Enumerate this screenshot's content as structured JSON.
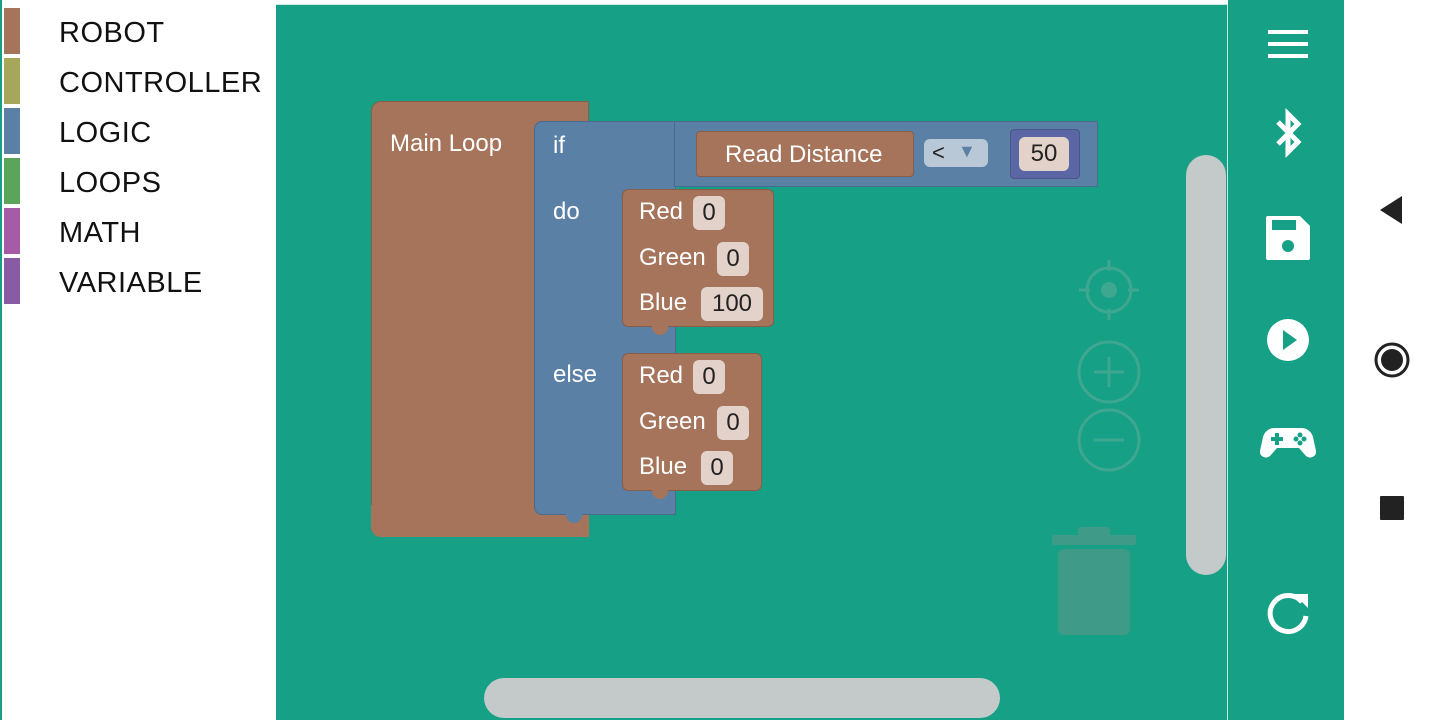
{
  "toolbox": {
    "categories": [
      {
        "label": "ROBOT",
        "color": "#a5745b"
      },
      {
        "label": "CONTROLLER",
        "color": "#a6a75b"
      },
      {
        "label": "LOGIC",
        "color": "#5b80a5"
      },
      {
        "label": "LOOPS",
        "color": "#5ba55b"
      },
      {
        "label": "MATH",
        "color": "#a55ba5"
      },
      {
        "label": "VARIABLE",
        "color": "#8a5ba5"
      }
    ]
  },
  "workspace": {
    "background": "#16a085",
    "main_loop": {
      "label": "Main Loop",
      "color": "#a5745b"
    },
    "if_block": {
      "color": "#5b80a5",
      "if_label": "if",
      "do_label": "do",
      "else_label": "else",
      "condition": {
        "left": {
          "label": "Read Distance",
          "color": "#a5745b"
        },
        "operator": "<",
        "right": {
          "value": "50",
          "color": "#5b67a5"
        }
      },
      "do_led": {
        "red_label": "Red",
        "red": "0",
        "green_label": "Green",
        "green": "0",
        "blue_label": "Blue",
        "blue": "100"
      },
      "else_led": {
        "red_label": "Red",
        "red": "0",
        "green_label": "Green",
        "green": "0",
        "blue_label": "Blue",
        "blue": "0"
      }
    },
    "controls": [
      "recenter-icon",
      "zoom-in-icon",
      "zoom-out-icon",
      "trash-icon"
    ]
  },
  "appbar": {
    "background": "#16a085",
    "buttons": [
      "menu-icon",
      "bluetooth-icon",
      "save-icon",
      "play-icon",
      "gamepad-icon",
      "refresh-icon"
    ]
  },
  "navbar": {
    "buttons": [
      "back-icon",
      "home-icon",
      "recents-icon"
    ]
  }
}
